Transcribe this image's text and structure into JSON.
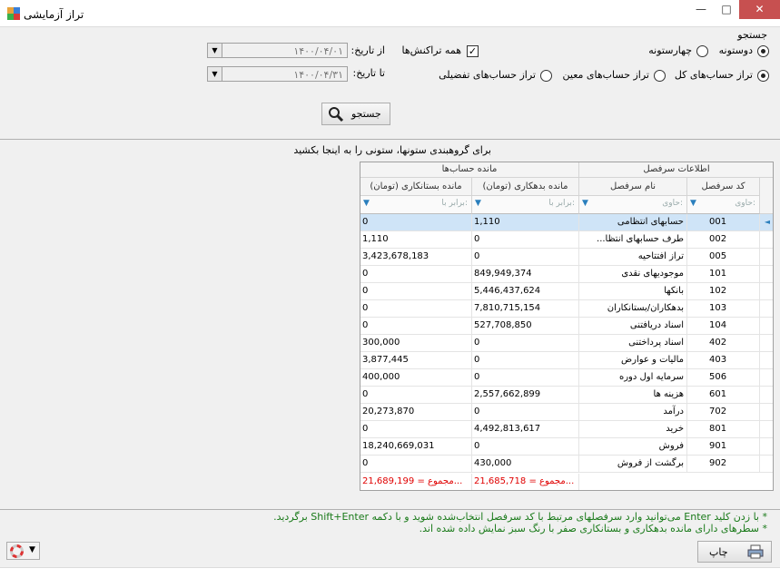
{
  "window": {
    "title": "تراز آزمایشی",
    "min": "—",
    "max": "□",
    "close": "✕"
  },
  "search": {
    "group_label": "جستجو",
    "radio_two_col": "دوستونه",
    "radio_four_col": "چهارستونه",
    "all_transactions": "همه تراکنش‌ها",
    "check_mark": "✓",
    "from_label": "از تاریخ:",
    "to_label": "تا تاریخ:",
    "from_value": "۱۴۰۰/۰۴/۰۱",
    "to_value": "۱۴۰۰/۰۴/۳۱",
    "radio_general": "تراز حساب‌های کل",
    "radio_specific": "تراز حساب‌های معین",
    "radio_detailed": "تراز حساب‌های تفضیلی",
    "button": "جستجو"
  },
  "grid": {
    "group_hint": "برای گروهبندی ستونها، ستونی را به اینجا بکشید",
    "band_account_info": "اطلاعات سرفصل",
    "band_balance": "مانده حساب‌ها",
    "col_code": "کد سرفصل",
    "col_name": "نام سرفصل",
    "col_debit": "مانده بدهکاری (تومان)",
    "col_credit": "مانده بستانکاری (تومان)",
    "filter_contains": "حاوی:",
    "filter_equals": "برابر با:",
    "rows": [
      {
        "code": "001",
        "name": "حسابهای انتظامی",
        "debit": "1,110",
        "credit": "0"
      },
      {
        "code": "002",
        "name": "طرف حسابهای انتظا...",
        "debit": "0",
        "credit": "1,110"
      },
      {
        "code": "005",
        "name": "تراز افتتاحیه",
        "debit": "0",
        "credit": "3,423,678,183"
      },
      {
        "code": "101",
        "name": "موجودیهای نقدی",
        "debit": "849,949,374",
        "credit": "0"
      },
      {
        "code": "102",
        "name": "بانکها",
        "debit": "5,446,437,624",
        "credit": "0"
      },
      {
        "code": "103",
        "name": "بدهکاران/بستانکاران",
        "debit": "7,810,715,154",
        "credit": "0"
      },
      {
        "code": "104",
        "name": "اسناد دریافتنی",
        "debit": "527,708,850",
        "credit": "0"
      },
      {
        "code": "402",
        "name": "اسناد پرداختنی",
        "debit": "0",
        "credit": "300,000"
      },
      {
        "code": "403",
        "name": "مالیات و عوارض",
        "debit": "0",
        "credit": "3,877,445"
      },
      {
        "code": "506",
        "name": "سرمایه اول دوره",
        "debit": "0",
        "credit": "400,000"
      },
      {
        "code": "601",
        "name": "هزینه ها",
        "debit": "2,557,662,899",
        "credit": "0"
      },
      {
        "code": "702",
        "name": "درآمد",
        "debit": "0",
        "credit": "20,273,870"
      },
      {
        "code": "801",
        "name": "خرید",
        "debit": "4,492,813,617",
        "credit": "0"
      },
      {
        "code": "901",
        "name": "فروش",
        "debit": "0",
        "credit": "18,240,669,031"
      },
      {
        "code": "902",
        "name": "برگشت از فروش",
        "debit": "430,000",
        "credit": "0"
      }
    ],
    "sum_debit": "مجموع = 21,685,718...",
    "sum_credit": "مجموع = 21,689,199..."
  },
  "notes": {
    "note1": "* با زدن کلید Enter می‌توانید وارد سرفصلهای مرتبط با کد سرفصل انتخاب‌شده شوید و با دکمه Shift+Enter برگردید.",
    "note2": "* سطرهای دارای مانده بدهکاری و بستانکاری صفر با رنگ سبز نمایش داده شده اند."
  },
  "print_button": "چاپ",
  "colors": {
    "selection": "#cfe4f7",
    "note_green": "#1a7a1a",
    "sum_red": "#e00000",
    "close_red": "#c75050"
  }
}
